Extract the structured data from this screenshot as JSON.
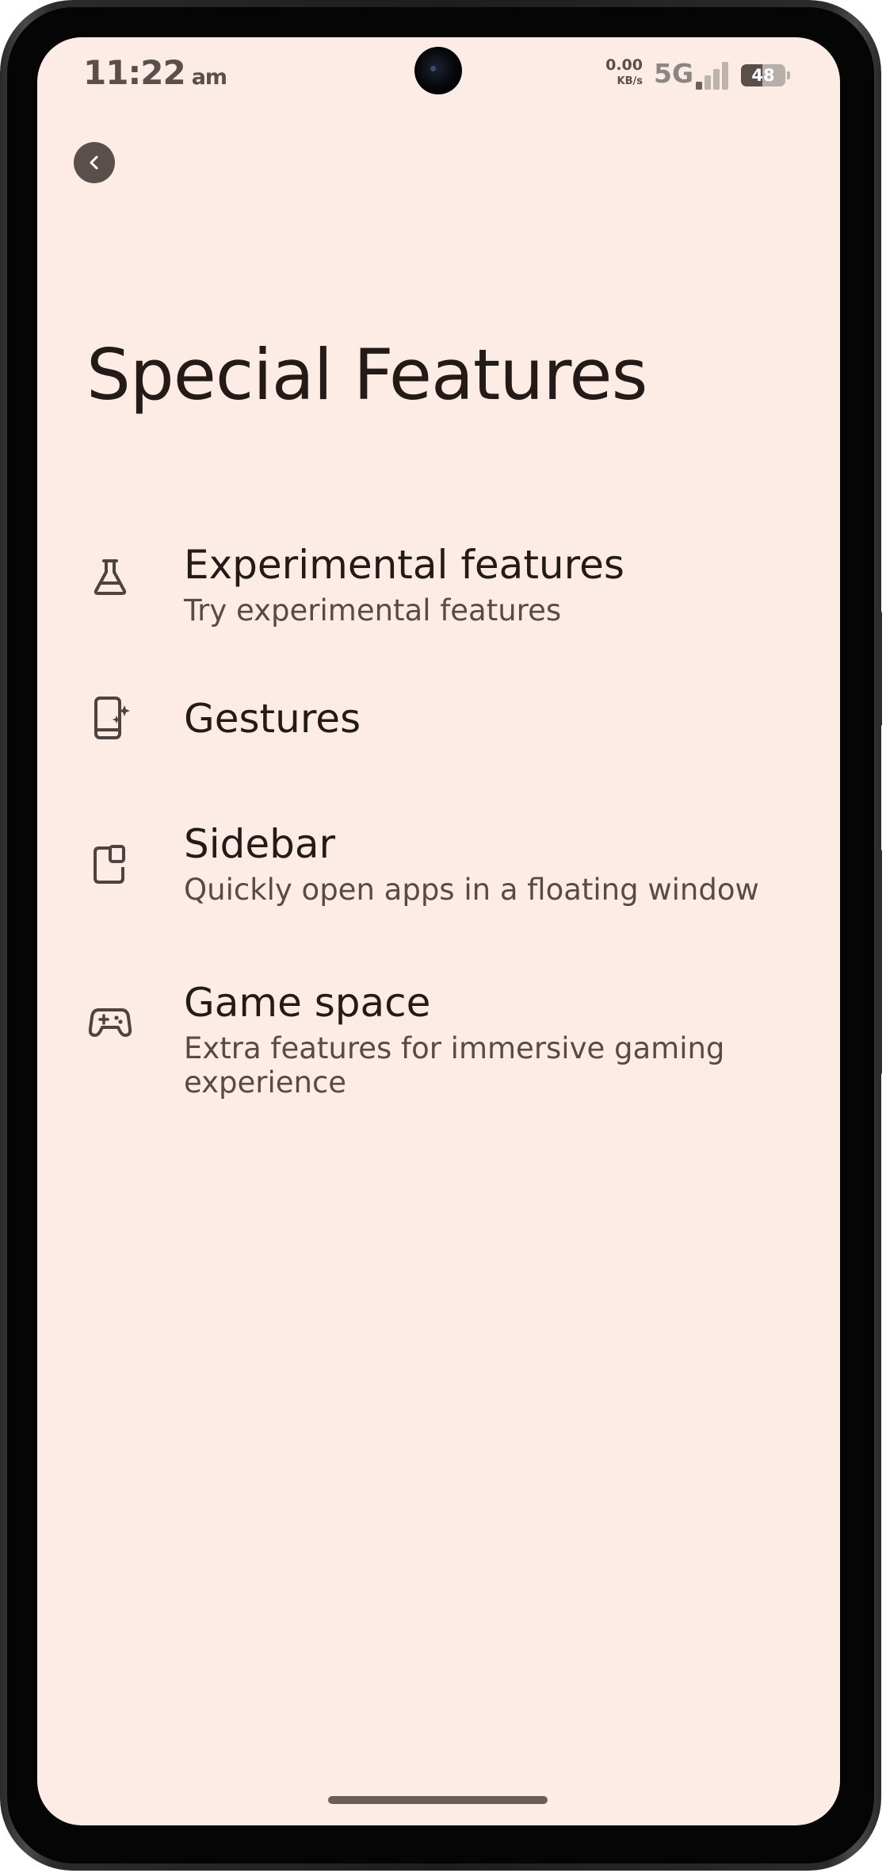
{
  "status_bar": {
    "time": "11:22",
    "ampm": "am",
    "net_speed_value": "0.00",
    "net_speed_unit": "KB/s",
    "network": "5G",
    "battery": "48",
    "signal_icon": "signal-icon"
  },
  "header": {
    "back_icon": "chevron-left-icon",
    "title": "Special Features"
  },
  "items": [
    {
      "icon": "flask-icon",
      "title": "Experimental features",
      "subtitle": "Try experimental features"
    },
    {
      "icon": "phone-sparkle-icon",
      "title": "Gestures",
      "subtitle": ""
    },
    {
      "icon": "sidebar-window-icon",
      "title": "Sidebar",
      "subtitle": "Quickly open apps in a floating window"
    },
    {
      "icon": "gamepad-icon",
      "title": "Game space",
      "subtitle": "Extra features for immersive gaming experience"
    }
  ],
  "colors": {
    "background": "#fcece5",
    "title_text": "#241a18",
    "subtitle_text": "#5a4a46",
    "icon": "#4e4340"
  }
}
